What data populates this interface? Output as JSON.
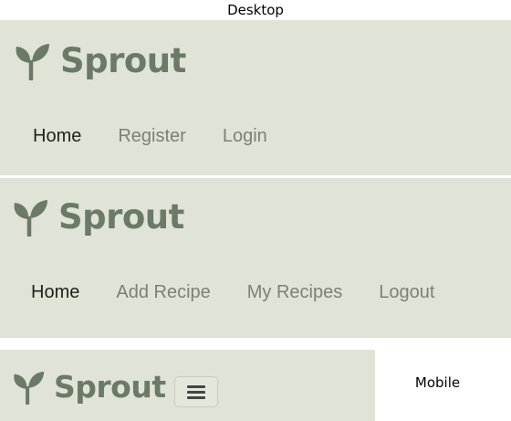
{
  "labels": {
    "desktop": "Desktop",
    "mobile": "Mobile"
  },
  "brand": {
    "name": "Sprout",
    "icon": "sprout-icon",
    "color": "#6b7a66"
  },
  "navbar_background": "#dfe4d6",
  "desktop_guest": {
    "links": [
      {
        "label": "Home",
        "active": true
      },
      {
        "label": "Register",
        "active": false
      },
      {
        "label": "Login",
        "active": false
      }
    ]
  },
  "desktop_user": {
    "links": [
      {
        "label": "Home",
        "active": true
      },
      {
        "label": "Add Recipe",
        "active": false
      },
      {
        "label": "My Recipes",
        "active": false
      },
      {
        "label": "Logout",
        "active": false
      }
    ]
  },
  "mobile": {
    "toggler_icon": "hamburger-icon"
  }
}
